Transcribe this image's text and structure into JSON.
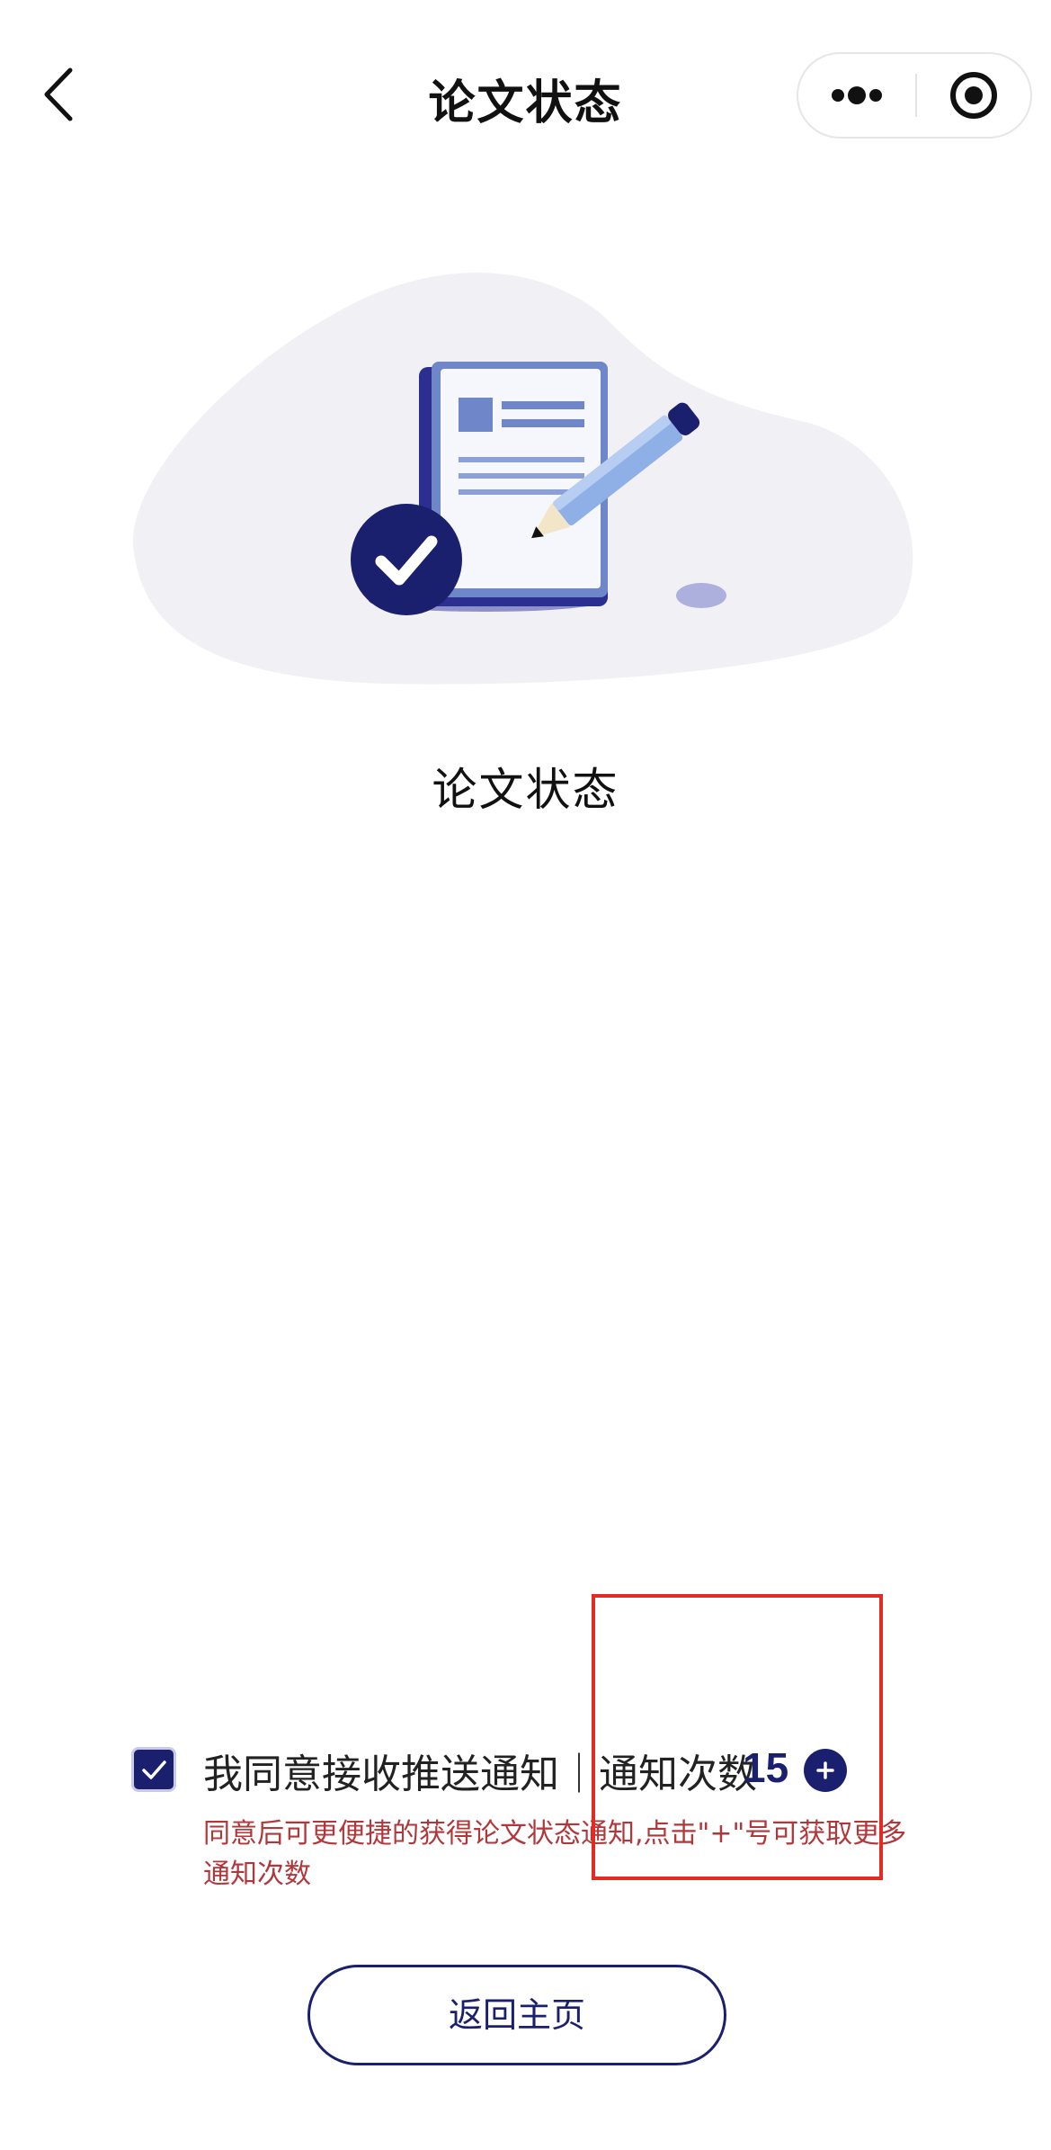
{
  "nav": {
    "title": "论文状态",
    "back_icon": "chevron-left-icon",
    "more_icon": "more-dots-icon",
    "close_icon": "record-circle-icon"
  },
  "hero": {
    "illustration_icon": "document-pencil-check-icon",
    "caption": "论文状态"
  },
  "consent": {
    "checked": true,
    "label": "我同意接收推送通知｜通知次数",
    "count": "15",
    "plus_icon": "plus-circle-icon",
    "hint": "同意后可更便捷的获得论文状态通知,点击\"+\"号可获取更多通知次数"
  },
  "actions": {
    "home_label": "返回主页"
  },
  "colors": {
    "brand": "#1a1f6e",
    "hint": "#b1373a",
    "annotation": "#e32b22",
    "illustration_bg": "#f1f1f5"
  }
}
